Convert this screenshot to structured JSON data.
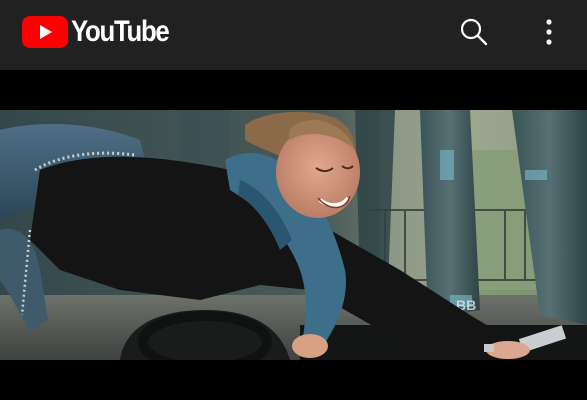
{
  "app": {
    "brand_text": "YouTube",
    "brand_color": "#ff0000",
    "header_bg": "#212121",
    "page_bg": "#000000"
  },
  "header": {
    "logo_icon": "youtube-play-logo-icon",
    "actions": [
      {
        "name": "search",
        "icon": "search-icon"
      },
      {
        "name": "more",
        "icon": "more-vertical-icon"
      }
    ]
  },
  "player": {
    "state": "video frame shown",
    "frame_icon": "video-frame"
  }
}
